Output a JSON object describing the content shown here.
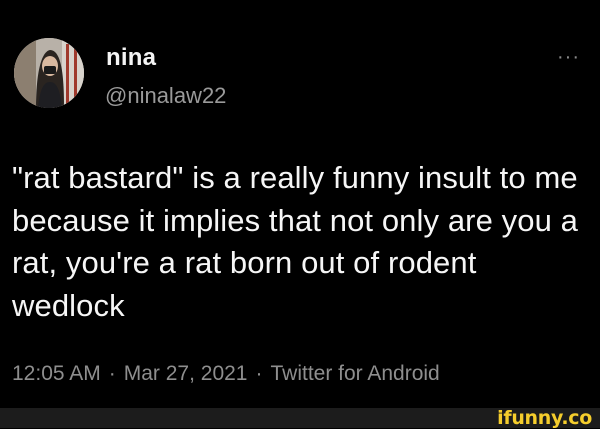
{
  "tweet": {
    "author": {
      "display_name": "nina",
      "handle": "@ninalaw22",
      "avatar_icon": "profile-photo"
    },
    "more_icon": "more-options-icon",
    "more_glyph": "···",
    "text": "\"rat bastard\" is a really funny insult to me because it implies that not only are you a rat, you're a rat born out of rodent wedlock",
    "meta": {
      "time": "12:05 AM",
      "separator": "·",
      "date": "Mar 27, 2021",
      "client": "Twitter for Android"
    }
  },
  "watermark": {
    "text": "ifunny.co",
    "color": "#f5cd2c"
  },
  "colors": {
    "background": "#000000",
    "primary_text": "#f6f6f6",
    "secondary_text": "#8e8e8e",
    "bar": "#1c1c1c"
  }
}
